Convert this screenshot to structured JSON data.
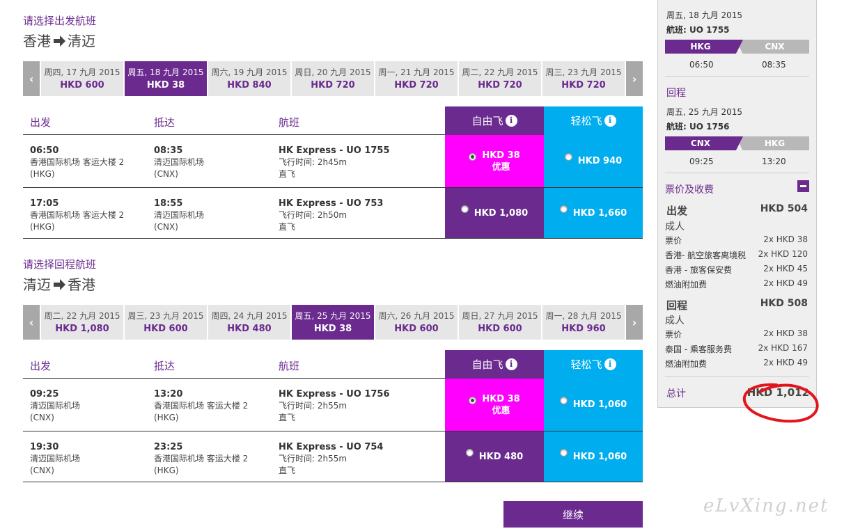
{
  "outbound": {
    "section_title": "请选择出发航班",
    "from": "香港",
    "to": "清迈",
    "dates": [
      {
        "date": "周四, 17 九月 2015",
        "price": "HKD 600",
        "selected": false
      },
      {
        "date": "周五, 18 九月 2015",
        "price": "HKD 38",
        "selected": true
      },
      {
        "date": "周六, 19 九月 2015",
        "price": "HKD 840",
        "selected": false
      },
      {
        "date": "周日, 20 九月 2015",
        "price": "HKD 720",
        "selected": false
      },
      {
        "date": "周一, 21 九月 2015",
        "price": "HKD 720",
        "selected": false
      },
      {
        "date": "周二, 22 九月 2015",
        "price": "HKD 720",
        "selected": false
      },
      {
        "date": "周三, 23 九月 2015",
        "price": "HKD 720",
        "selected": false
      }
    ],
    "flights": [
      {
        "dep_time": "06:50",
        "dep_airport": "香港国际机场 客运大楼 2",
        "dep_code": "(HKG)",
        "arr_time": "08:35",
        "arr_airport": "清迈国际机场",
        "arr_code": "(CNX)",
        "flight": "HK Express - UO 1755",
        "duration": "飞行时间: 2h45m",
        "stops": "直飞",
        "fare_free": "HKD 38",
        "fare_free_tag": "优惠",
        "fare_easy": "HKD 940",
        "selected_free": true
      },
      {
        "dep_time": "17:05",
        "dep_airport": "香港国际机场 客运大楼 2",
        "dep_code": "(HKG)",
        "arr_time": "18:55",
        "arr_airport": "清迈国际机场",
        "arr_code": "(CNX)",
        "flight": "HK Express - UO 753",
        "duration": "飞行时间: 2h50m",
        "stops": "直飞",
        "fare_free": "HKD 1,080",
        "fare_free_tag": "",
        "fare_easy": "HKD 1,660",
        "selected_free": false
      }
    ]
  },
  "return": {
    "section_title": "请选择回程航班",
    "from": "清迈",
    "to": "香港",
    "dates": [
      {
        "date": "周二, 22 九月 2015",
        "price": "HKD 1,080",
        "selected": false
      },
      {
        "date": "周三, 23 九月 2015",
        "price": "HKD 600",
        "selected": false
      },
      {
        "date": "周四, 24 九月 2015",
        "price": "HKD 480",
        "selected": false
      },
      {
        "date": "周五, 25 九月 2015",
        "price": "HKD 38",
        "selected": true
      },
      {
        "date": "周六, 26 九月 2015",
        "price": "HKD 600",
        "selected": false
      },
      {
        "date": "周日, 27 九月 2015",
        "price": "HKD 600",
        "selected": false
      },
      {
        "date": "周一, 28 九月 2015",
        "price": "HKD 960",
        "selected": false
      }
    ],
    "flights": [
      {
        "dep_time": "09:25",
        "dep_airport": "清迈国际机场",
        "dep_code": "(CNX)",
        "arr_time": "13:20",
        "arr_airport": "香港国际机场 客运大楼 2",
        "arr_code": "(HKG)",
        "flight": "HK Express - UO 1756",
        "duration": "飞行时间: 2h55m",
        "stops": "直飞",
        "fare_free": "HKD 38",
        "fare_free_tag": "优惠",
        "fare_easy": "HKD 1,060",
        "selected_free": true
      },
      {
        "dep_time": "19:30",
        "dep_airport": "清迈国际机场",
        "dep_code": "(CNX)",
        "arr_time": "23:25",
        "arr_airport": "香港国际机场 客运大楼 2",
        "arr_code": "(HKG)",
        "flight": "HK Express - UO 754",
        "duration": "飞行时间: 2h55m",
        "stops": "直飞",
        "fare_free": "HKD 480",
        "fare_free_tag": "",
        "fare_easy": "HKD 1,060",
        "selected_free": false
      }
    ]
  },
  "table_headers": {
    "depart": "出发",
    "arrive": "抵达",
    "flight": "航班",
    "fare_free": "自由飞",
    "fare_easy": "轻松飞",
    "info_glyph": "i"
  },
  "continue_label": "继续",
  "summary": {
    "out": {
      "date": "周五, 18 九月 2015",
      "flight": "航班: UO 1755",
      "from": "HKG",
      "to": "CNX",
      "dep": "06:50",
      "arr": "08:35"
    },
    "ret_title": "回程",
    "ret": {
      "date": "周五, 25 九月 2015",
      "flight": "航班: UO 1756",
      "from": "CNX",
      "to": "HKG",
      "dep": "09:25",
      "arr": "13:20"
    },
    "fees_title": "票价及收费",
    "out_section": {
      "title": "出发",
      "total": "HKD 504",
      "pax": "成人",
      "lines": [
        {
          "label": "票价",
          "value": "2x HKD 38"
        },
        {
          "label": "香港- 航空旅客离境税",
          "value": "2x HKD 120"
        },
        {
          "label": "香港 - 旅客保安费",
          "value": "2x HKD 45"
        },
        {
          "label": "燃油附加费",
          "value": "2x HKD 49"
        }
      ]
    },
    "ret_section": {
      "title": "回程",
      "total": "HKD 508",
      "pax": "成人",
      "lines": [
        {
          "label": "票价",
          "value": "2x HKD 38"
        },
        {
          "label": "泰国 - 乘客服务费",
          "value": "2x HKD 167"
        },
        {
          "label": "燃油附加费",
          "value": "2x HKD 49"
        }
      ]
    },
    "total_label": "总计",
    "total_value": "HKD 1,012"
  },
  "watermark": "eLvXing.net",
  "colors": {
    "purple": "#6a2a8e",
    "cyan": "#00aeef",
    "magenta": "#ff00ff",
    "gray": "#e6e6e6"
  },
  "icons": {
    "prev": "chevron-left-icon",
    "next": "chevron-right-icon",
    "arrow": "arrow-right-icon",
    "info": "info-icon",
    "collapse": "minus-icon"
  }
}
